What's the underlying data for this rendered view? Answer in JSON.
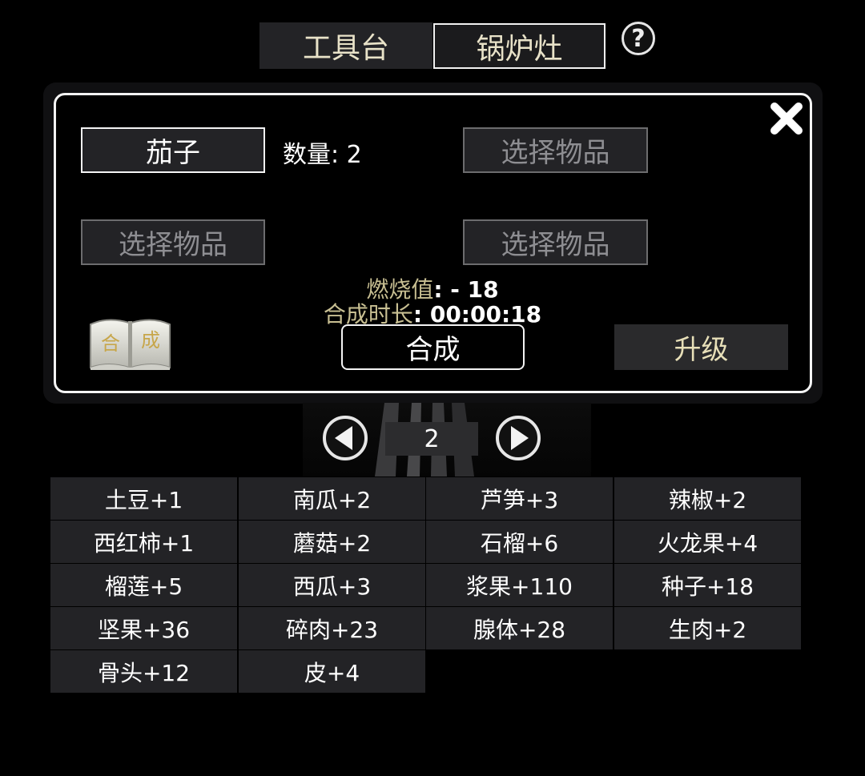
{
  "tabs": {
    "workbench": "工具台",
    "stove": "锅炉灶",
    "help": "?"
  },
  "panel": {
    "slots": [
      "茄子",
      "选择物品",
      "选择物品",
      "选择物品"
    ],
    "quantity_label": "数量: 2",
    "burn_label": "燃烧值",
    "burn_value": ": - 18",
    "time_label": "合成时长",
    "time_value": ": 00:00:18",
    "recipe_book_text": [
      "合",
      "成"
    ],
    "craft_button": "合成",
    "upgrade_button": "升级"
  },
  "pager": {
    "page": "2"
  },
  "items": [
    "土豆+1",
    "南瓜+2",
    "芦笋+3",
    "辣椒+2",
    "西红柿+1",
    "蘑菇+2",
    "石榴+6",
    "火龙果+4",
    "榴莲+5",
    "西瓜+3",
    "浆果+110",
    "种子+18",
    "坚果+36",
    "碎肉+23",
    "腺体+28",
    "生肉+2",
    "骨头+12",
    "皮+4"
  ],
  "colors": {
    "background": "#000000",
    "cell": "#232326",
    "label_gold": "#c8bf92",
    "border": "#f4f4f4"
  },
  "icons": {
    "help": "question-circle-icon",
    "close": "close-x-icon",
    "book": "recipe-book-icon",
    "prev": "arrow-left-circle-icon",
    "next": "arrow-right-circle-icon"
  }
}
